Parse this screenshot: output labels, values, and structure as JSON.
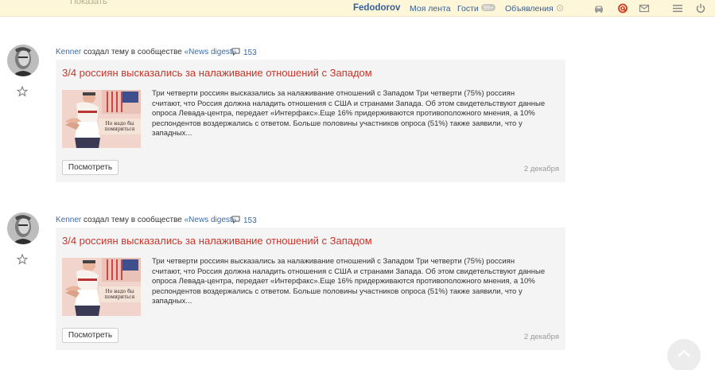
{
  "topbar": {
    "ghost_text": "Показать",
    "username": "Fedodorov",
    "nav": {
      "feed": "Моя лента",
      "guests": "Гости",
      "guests_badge": "99+",
      "ads": "Объявления"
    },
    "icons": [
      "car-icon",
      "at-icon",
      "mail-icon",
      "menu-icon",
      "power-icon"
    ]
  },
  "posts": [
    {
      "author": "Kenner",
      "action": "создал тему в сообществе",
      "community": "«News digest»",
      "comments": "153",
      "title": "3/4 россиян высказались за налаживание отношений с Западом",
      "image_caption": "Но надо бы помириться",
      "text": "Три четверти россиян высказались за налаживание отношений с Западом Три четверти (75%) россиян считают, что Россия должна наладить отношения с США и странами Запада. Об этом свидетельствуют данные опроса Левада-центра, передает «Интерфакс».Еще 16% придерживаются противоположного мнения, а 10% респондентов воздержались с ответом. Больше половины участников опроса (51%) также заявили, что у западных...",
      "button": "Посмотреть",
      "date": "2 декабря"
    },
    {
      "author": "Kenner",
      "action": "создал тему в сообществе",
      "community": "«News digest»",
      "comments": "153",
      "title": "3/4 россиян высказались за налаживание отношений с Западом",
      "image_caption": "Но надо бы помириться",
      "text": "Три четверти россиян высказались за налаживание отношений с Западом Три четверти (75%) россиян считают, что Россия должна наладить отношения с США и странами Запада. Об этом свидетельствуют данные опроса Левада-центра, передает «Интерфакс».Еще 16% придерживаются противоположного мнения, а 10% респондентов воздержались с ответом. Больше половины участников опроса (51%) также заявили, что у западных...",
      "button": "Посмотреть",
      "date": "2 декабря"
    }
  ],
  "colors": {
    "topbar_bg": "#fdf6d8",
    "link": "#3b6aa7",
    "title": "#c8362b",
    "card_bg": "#f4f4f4"
  }
}
